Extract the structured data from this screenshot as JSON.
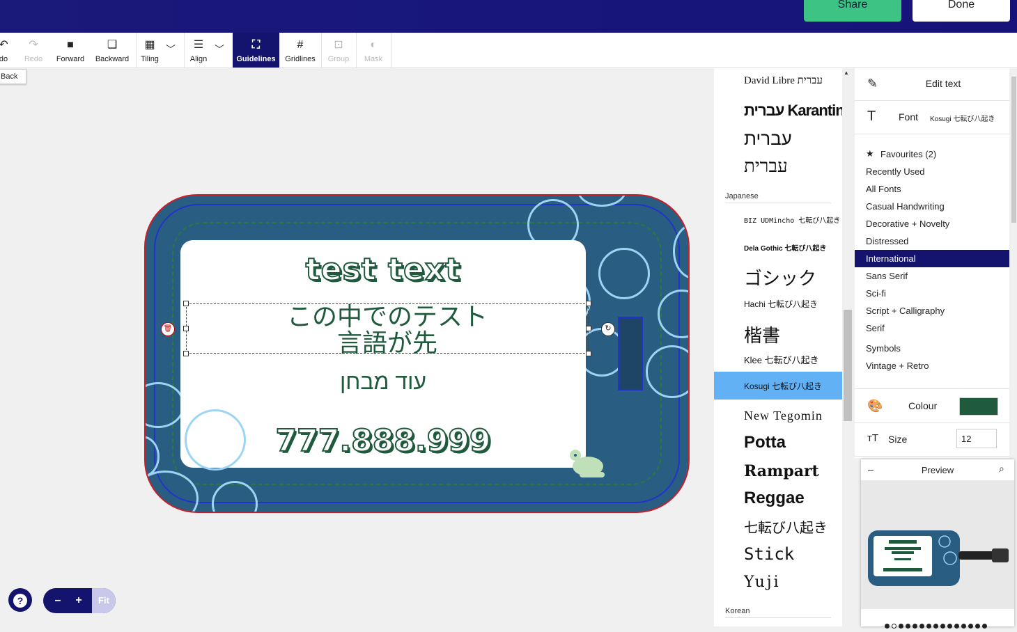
{
  "header": {
    "share_label": "Share",
    "done_label": "Done"
  },
  "toolbar": {
    "undo": "do",
    "redo": "Redo",
    "forward": "Forward",
    "backward": "Backward",
    "tiling": "Tiling",
    "align": "Align",
    "guidelines": "Guidelines",
    "gridlines": "Gridlines",
    "group": "Group",
    "mask": "Mask"
  },
  "back_label": "Back",
  "canvas": {
    "title_text": "test text",
    "jp_line1": "この中でのテスト",
    "jp_line2": "言語が先",
    "he_text": "עוד מבחן",
    "number_text": "777.888.999",
    "tag_color": "#2a5d82",
    "text_color": "#1f5a3c"
  },
  "zoom": {
    "minus": "–",
    "plus": "+",
    "fit": "Fit"
  },
  "help_label": "?",
  "font_list": {
    "items": [
      {
        "name": "David Libre עברית"
      },
      {
        "name": "עברית Karantina"
      },
      {
        "name": "עברית"
      },
      {
        "name": "עברית"
      },
      {
        "name": "BIZ UDMincho 七転び八起き"
      },
      {
        "name": "Dela Gothic 七転び八起き"
      },
      {
        "name": "ゴシック"
      },
      {
        "name": "Hachi 七転び八起き"
      },
      {
        "name": "楷書"
      },
      {
        "name": "Klee 七転び八起き"
      },
      {
        "name": "Kosugi 七転び八起き"
      },
      {
        "name": "New Tegomin"
      },
      {
        "name": "Potta"
      },
      {
        "name": "Rampart"
      },
      {
        "name": "Reggae"
      },
      {
        "name": "七転び八起き"
      },
      {
        "name": "Stick"
      },
      {
        "name": "Yuji"
      }
    ],
    "section_japanese": "Japanese",
    "section_korean": "Korean",
    "selected": "Kosugi 七転び八起き"
  },
  "panel": {
    "edit_text": "Edit text",
    "font_label": "Font",
    "font_value": "Kosugi 七転び八起き",
    "categories": [
      "Favourites (2)",
      "Recently Used",
      "All Fonts",
      "Casual Handwriting",
      "Decorative + Novelty",
      "Distressed",
      "International",
      "Sans Serif",
      "Sci-fi",
      "Script + Calligraphy",
      "Serif",
      "Symbols",
      "Vintage + Retro"
    ],
    "active_category": "International",
    "colour_label": "Colour",
    "colour_value": "#1f5a3c",
    "size_label": "Size",
    "size_value": "12"
  },
  "preview": {
    "title": "Preview",
    "minimize": "–"
  }
}
